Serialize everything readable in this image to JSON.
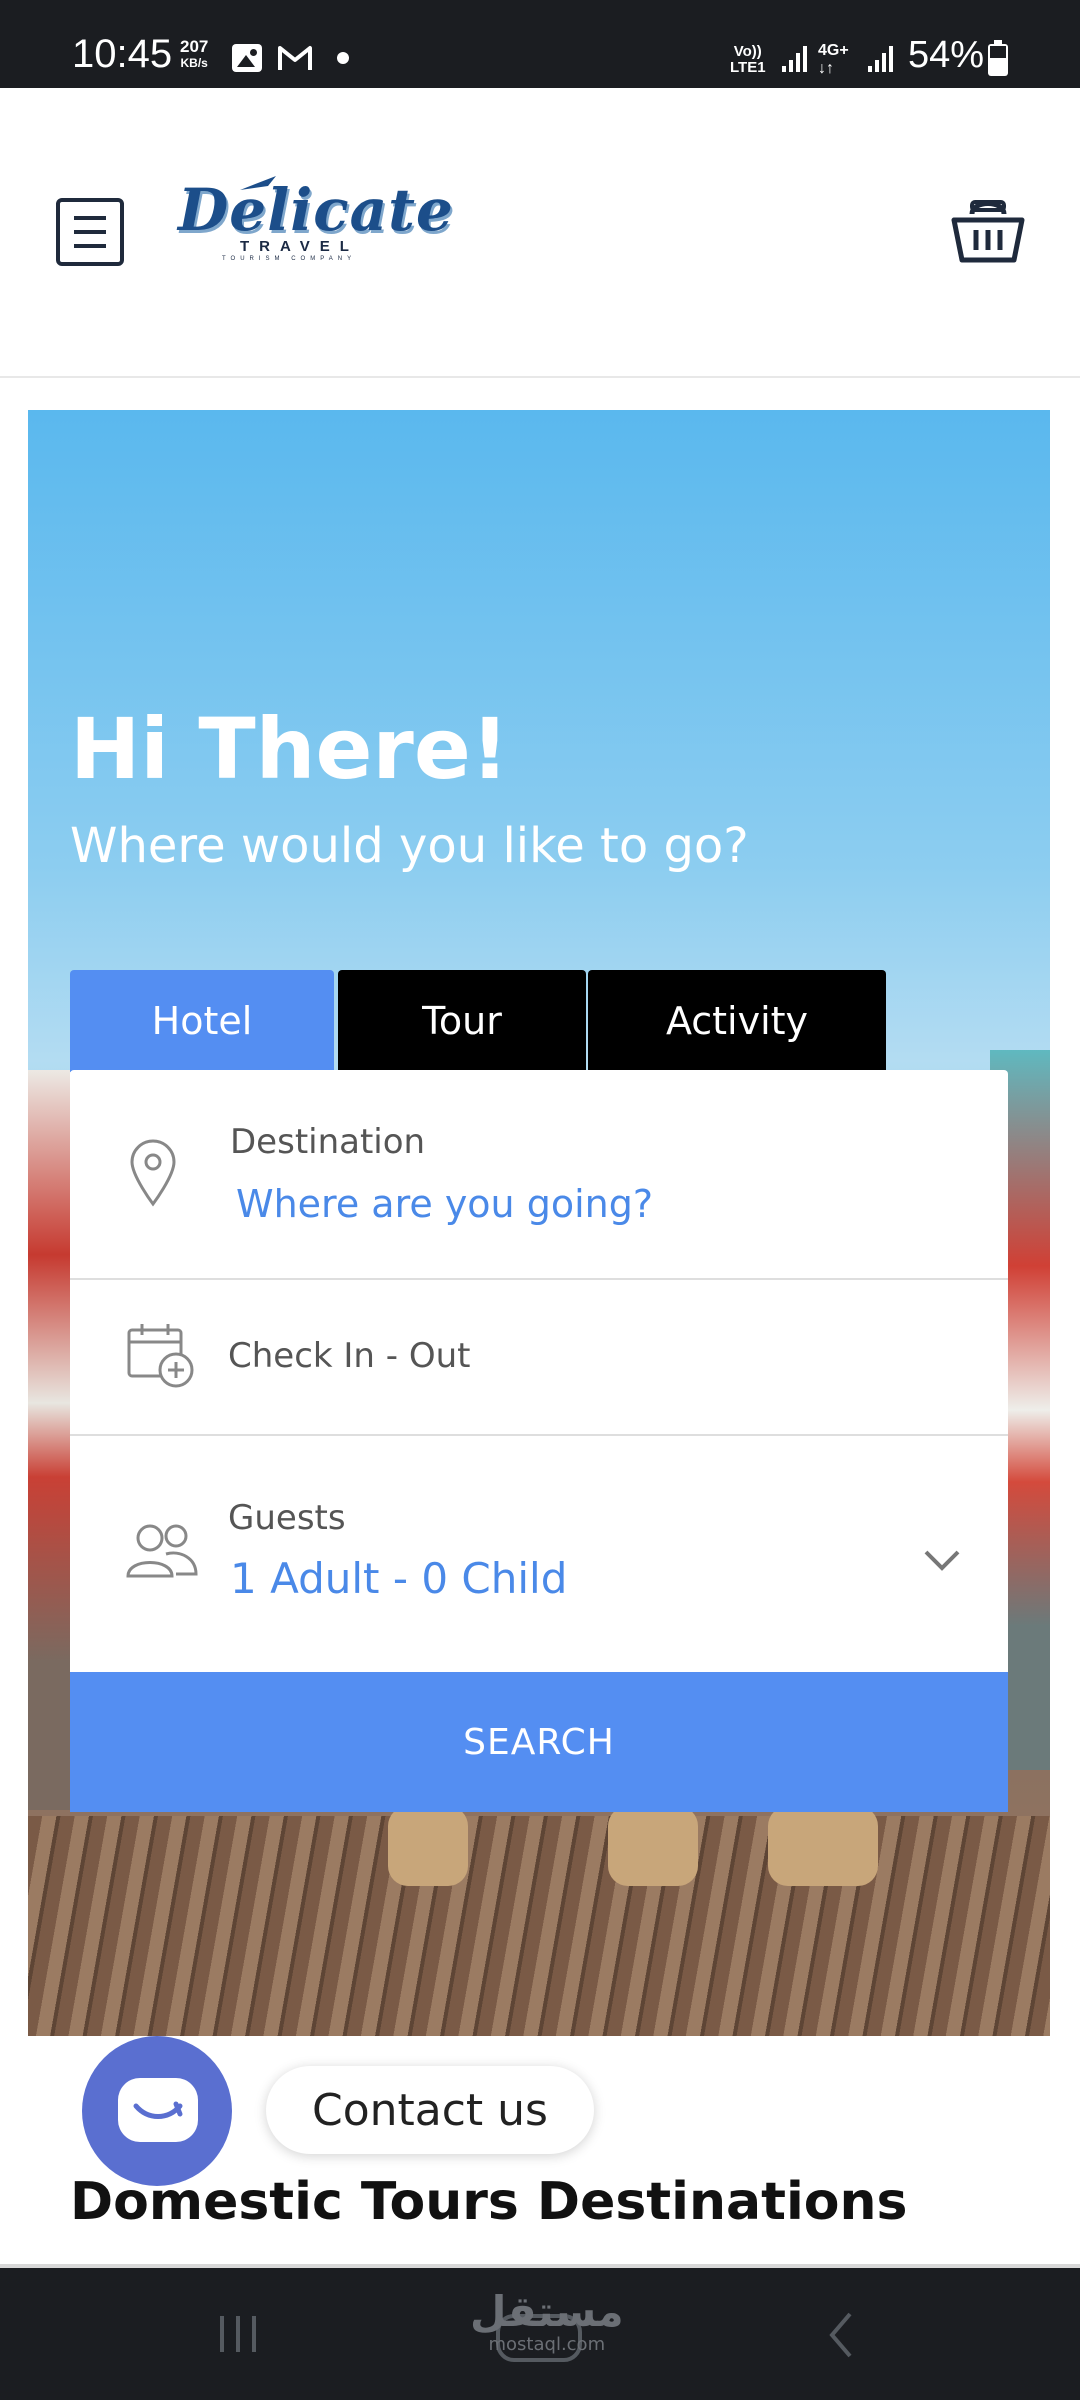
{
  "status_bar": {
    "time": "10:45",
    "speed_value": "207",
    "speed_unit": "KB/s",
    "volte_top": "Vo))",
    "volte_bottom": "LTE1",
    "network": "4G+",
    "battery": "54%",
    "icons": [
      "photo-icon",
      "gmail-icon",
      "notification-dot",
      "signal-icon",
      "battery-icon"
    ]
  },
  "header": {
    "logo_name": "Delicate",
    "logo_sub": "TRAVEL",
    "logo_tagline": "TOURISM COMPANY",
    "menu_icon": "hamburger-icon",
    "cart_icon": "basket-icon"
  },
  "hero": {
    "title": "Hi There!",
    "subtitle": "Where would you like to go?"
  },
  "tabs": [
    {
      "label": "Hotel",
      "active": true
    },
    {
      "label": "Tour",
      "active": false
    },
    {
      "label": "Activity",
      "active": false
    }
  ],
  "search": {
    "destination_label": "Destination",
    "destination_placeholder": "Where are you going?",
    "dates_label": "Check In - Out",
    "guests_label": "Guests",
    "guests_value": "1 Adult - 0 Child",
    "button_label": "SEARCH"
  },
  "contact": {
    "label": "Contact us"
  },
  "section": {
    "title": "Domestic Tours Destinations"
  },
  "watermark": {
    "arabic": "مستقل",
    "latin": "mostaql.com"
  },
  "colors": {
    "accent": "#548ef2",
    "link": "#4a89e8",
    "contact": "#5a6fd0",
    "system_bar": "#1b1d21"
  }
}
